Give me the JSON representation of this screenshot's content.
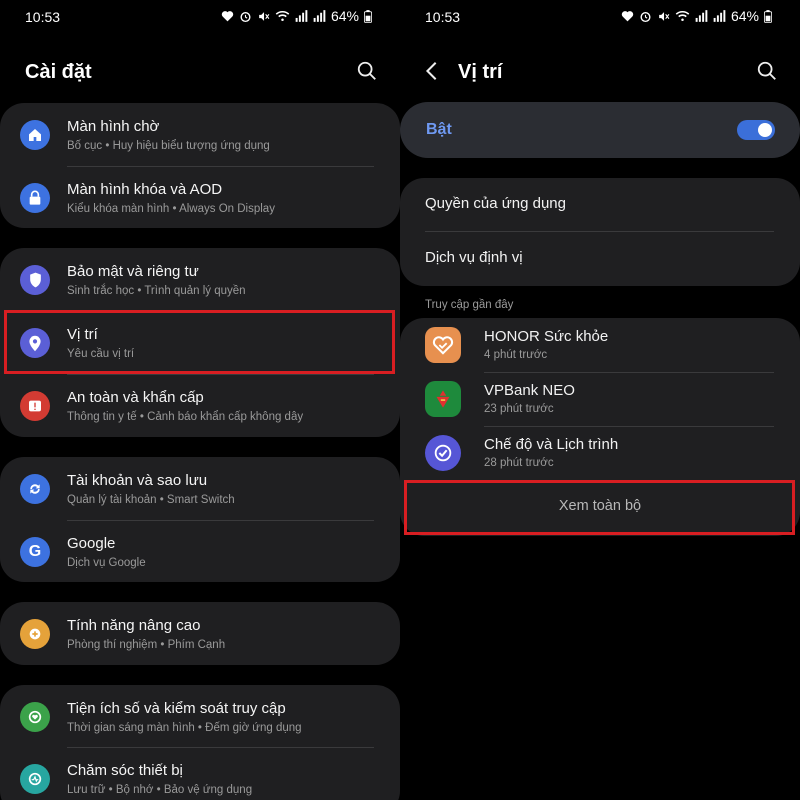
{
  "status": {
    "time": "10:53",
    "battery": "64%"
  },
  "left": {
    "title": "Cài đặt",
    "groups": [
      [
        {
          "icon": "home-icon",
          "color": "#3d72e0",
          "title": "Màn hình chờ",
          "subtitle": "Bố cục  •  Huy hiệu biểu tượng ứng dụng"
        },
        {
          "icon": "lock-icon",
          "color": "#3d72e0",
          "title": "Màn hình khóa và AOD",
          "subtitle": "Kiểu khóa màn hình  •  Always On Display"
        }
      ],
      [
        {
          "icon": "shield-icon",
          "color": "#5b5fd6",
          "title": "Bảo mật và riêng tư",
          "subtitle": "Sinh trắc học  •  Trình quản lý quyền"
        },
        {
          "icon": "location-pin-icon",
          "color": "#5b5fd6",
          "title": "Vị trí",
          "subtitle": "Yêu cầu vị trí"
        },
        {
          "icon": "alert-icon",
          "color": "#d33b33",
          "title": "An toàn và khẩn cấp",
          "subtitle": "Thông tin y tế  •  Cảnh báo khẩn cấp không dây"
        }
      ],
      [
        {
          "icon": "sync-icon",
          "color": "#3d72e0",
          "title": "Tài khoản và sao lưu",
          "subtitle": "Quản lý tài khoản  •  Smart Switch"
        },
        {
          "icon": "google-icon",
          "color": "#3d72e0",
          "title": "Google",
          "subtitle": "Dịch vụ Google"
        }
      ],
      [
        {
          "icon": "plus-gear-icon",
          "color": "#e5a23a",
          "title": "Tính năng nâng cao",
          "subtitle": "Phòng thí nghiệm  •  Phím Cạnh"
        }
      ],
      [
        {
          "icon": "wellbeing-icon",
          "color": "#3ba24a",
          "title": "Tiện ích số và kiểm soát truy cập",
          "subtitle": "Thời gian sáng màn hình  •  Đếm giờ ứng dụng"
        },
        {
          "icon": "device-care-icon",
          "color": "#27a6a0",
          "title": "Chăm sóc thiết bị",
          "subtitle": "Lưu trữ  •  Bộ nhớ  •  Bảo vệ ứng dụng"
        }
      ]
    ]
  },
  "right": {
    "title": "Vị trí",
    "toggle_label": "Bật",
    "toggle_on": true,
    "menu": [
      "Quyền của ứng dụng",
      "Dịch vụ định vị"
    ],
    "section_label": "Truy cập gần đây",
    "apps": [
      {
        "name": "HONOR Sức khỏe",
        "time": "4 phút trước",
        "icon": "honor-health-icon",
        "color": "#e7904f"
      },
      {
        "name": "VPBank NEO",
        "time": "23 phút trước",
        "icon": "vpbank-icon",
        "color": "#1e8a3c"
      },
      {
        "name": "Chế độ và Lịch trình",
        "time": "28 phút trước",
        "icon": "modes-routines-icon",
        "color": "#5656d6"
      }
    ],
    "see_all": "Xem toàn bộ"
  }
}
